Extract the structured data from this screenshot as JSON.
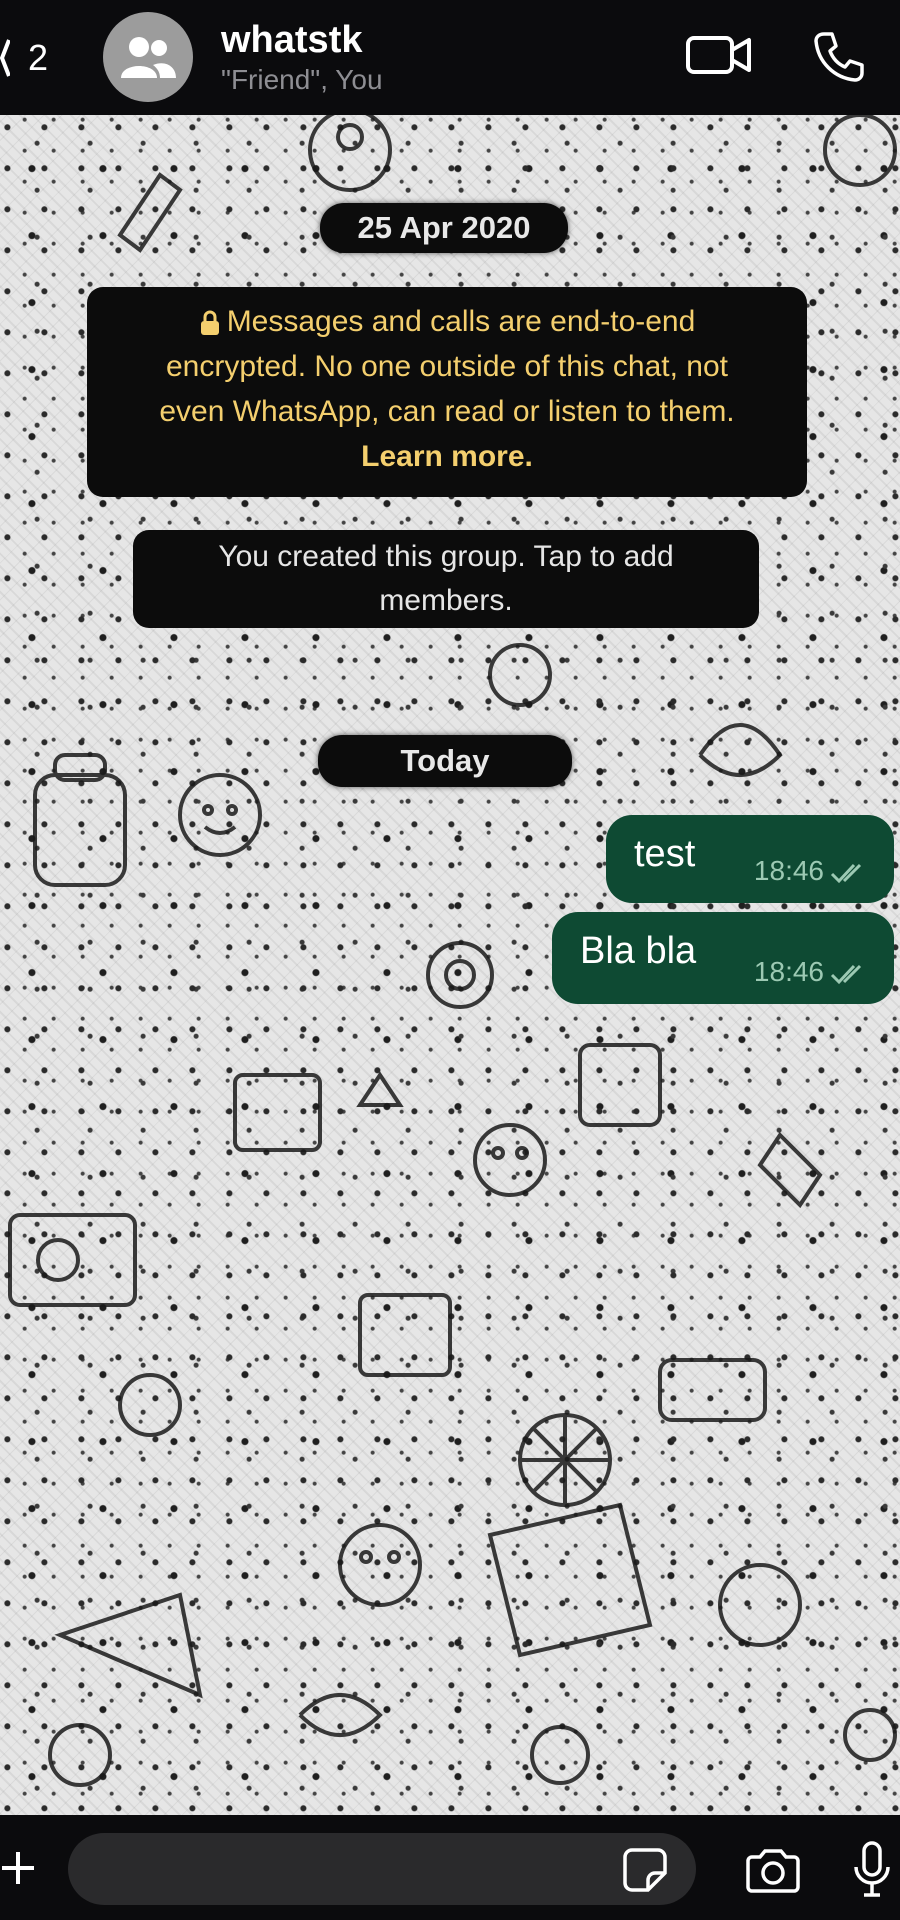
{
  "header": {
    "back_count": "2",
    "title": "whatstk",
    "subtitle": "\"Friend\", You",
    "icons": [
      "group-avatar-icon",
      "video-call-icon",
      "phone-icon"
    ]
  },
  "chat": {
    "date_first": "25 Apr 2020",
    "encryption_notice": {
      "line1": "Messages and calls are end-to-end",
      "line2": "encrypted. No one outside of this chat, not",
      "line3": "even WhatsApp, can read or listen to them.",
      "learn_more": "Learn more.",
      "text_color": "#f4cf6e"
    },
    "group_created": {
      "line1": "You created this group. Tap to add",
      "line2": "members."
    },
    "date_today": "Today",
    "messages": [
      {
        "text": "test",
        "time": "18:46",
        "status": "double-check-icon"
      },
      {
        "text": "Bla bla",
        "time": "18:46",
        "status": "double-check-icon"
      }
    ],
    "bubble_color": "#0e4a33"
  },
  "composer": {
    "placeholder": "",
    "value": "",
    "icons": [
      "plus-icon",
      "sticker-icon",
      "camera-icon",
      "microphone-icon"
    ]
  }
}
